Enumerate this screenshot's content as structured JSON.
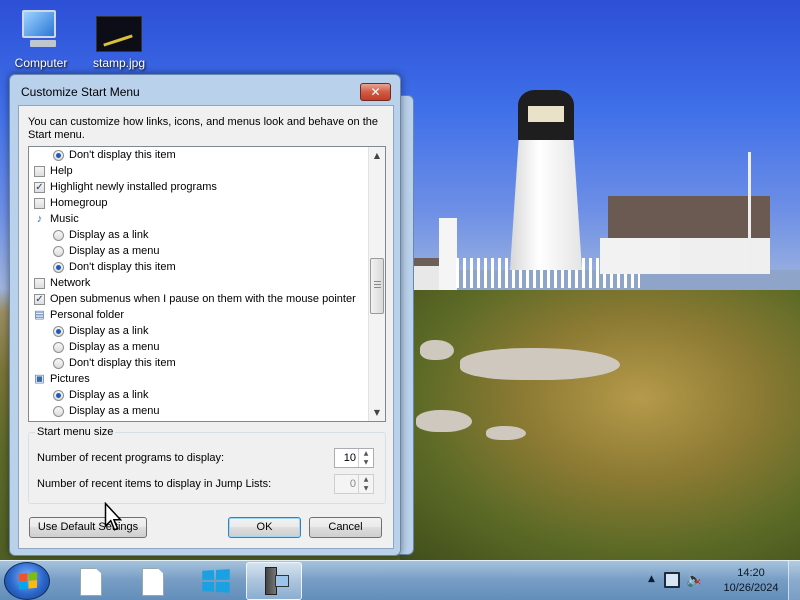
{
  "desktop": {
    "icons": [
      {
        "label": "Computer"
      },
      {
        "label": "stamp.jpg"
      }
    ]
  },
  "dialog": {
    "title": "Customize Start Menu",
    "close_glyph": "✕",
    "description": "You can customize how links, icons, and menus look and behave on the Start menu.",
    "list": {
      "items": [
        {
          "type": "radio",
          "level": 1,
          "checked": true,
          "label": "Don't display this item"
        },
        {
          "type": "checkbox",
          "level": 0,
          "checked": false,
          "label": "Help"
        },
        {
          "type": "checkbox",
          "level": 0,
          "checked": true,
          "label": "Highlight newly installed programs"
        },
        {
          "type": "checkbox",
          "level": 0,
          "checked": false,
          "label": "Homegroup"
        },
        {
          "type": "header",
          "level": 0,
          "icon": "music-note-icon",
          "label": "Music"
        },
        {
          "type": "radio",
          "level": 1,
          "checked": false,
          "label": "Display as a link"
        },
        {
          "type": "radio",
          "level": 1,
          "checked": false,
          "label": "Display as a menu"
        },
        {
          "type": "radio",
          "level": 1,
          "checked": true,
          "label": "Don't display this item"
        },
        {
          "type": "checkbox",
          "level": 0,
          "checked": false,
          "label": "Network"
        },
        {
          "type": "checkbox",
          "level": 0,
          "checked": true,
          "label": "Open submenus when I pause on them with the mouse pointer"
        },
        {
          "type": "header",
          "level": 0,
          "icon": "user-folder-icon",
          "label": "Personal folder"
        },
        {
          "type": "radio",
          "level": 1,
          "checked": true,
          "label": "Display as a link"
        },
        {
          "type": "radio",
          "level": 1,
          "checked": false,
          "label": "Display as a menu"
        },
        {
          "type": "radio",
          "level": 1,
          "checked": false,
          "label": "Don't display this item"
        },
        {
          "type": "header",
          "level": 0,
          "icon": "pictures-icon",
          "label": "Pictures"
        },
        {
          "type": "radio",
          "level": 1,
          "checked": true,
          "label": "Display as a link"
        },
        {
          "type": "radio",
          "level": 1,
          "checked": false,
          "label": "Display as a menu"
        }
      ]
    },
    "start_menu_size": {
      "label": "Start menu size",
      "recent_programs_label": "Number of recent programs to display:",
      "recent_programs_value": "10",
      "recent_items_label": "Number of recent items to display in Jump Lists:",
      "recent_items_value": "0"
    },
    "buttons": {
      "use_default": "Use Default Settings",
      "ok": "OK",
      "cancel": "Cancel"
    }
  },
  "taskbar": {
    "buttons": [
      {
        "icon": "document-icon"
      },
      {
        "icon": "document-icon"
      },
      {
        "icon": "windows-logo-icon"
      },
      {
        "icon": "server-manager-icon",
        "active": true
      }
    ],
    "tray": {
      "time": "14:20",
      "date": "10/26/2024"
    }
  },
  "colors": {
    "dialog_frame": "#b9d1ea",
    "close_button": "#c33d26",
    "default_button_border": "#3c7fb1"
  }
}
